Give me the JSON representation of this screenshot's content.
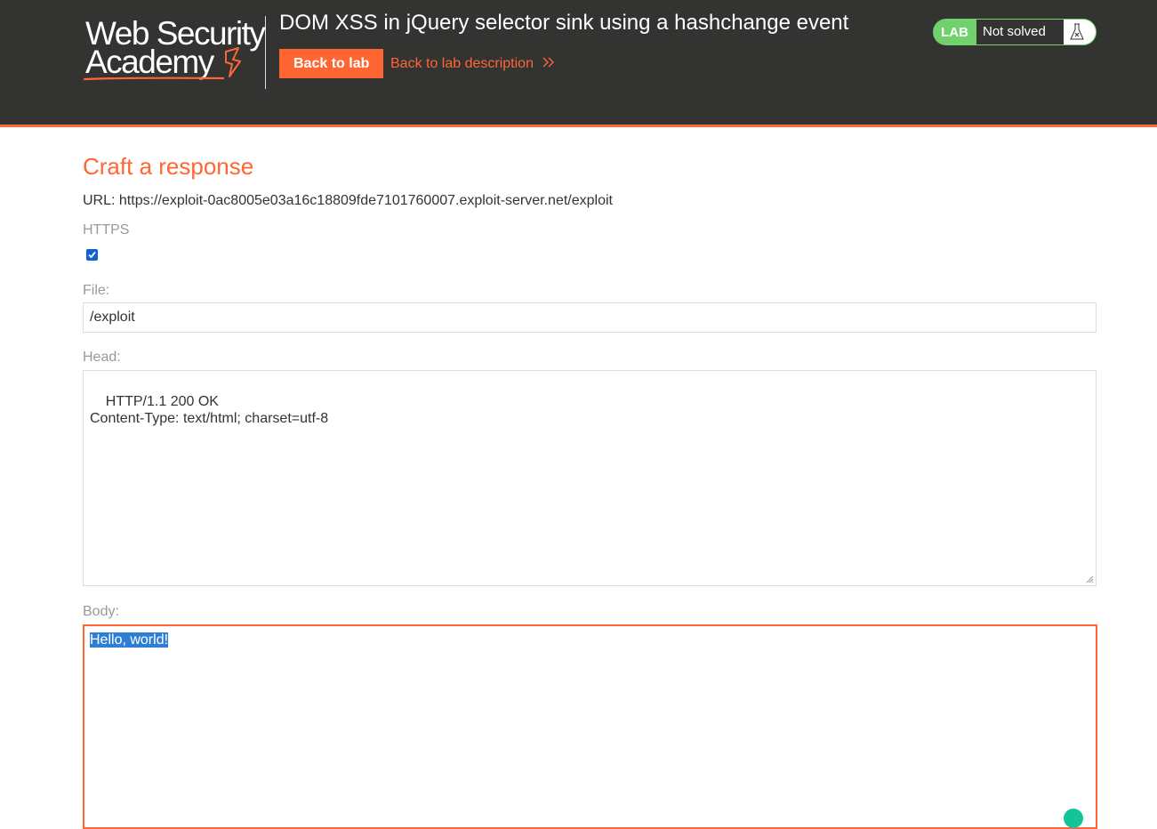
{
  "header": {
    "logo_line1": "Web Security",
    "logo_line2": "Academy",
    "lab_title": "DOM XSS in jQuery selector sink using a hashchange event",
    "back_to_lab": "Back to lab",
    "back_to_description": "Back to lab description",
    "lab_tag": "LAB",
    "lab_status": "Not solved",
    "accent_color": "#ff6633",
    "status_color": "#70d16d"
  },
  "form": {
    "title": "Craft a response",
    "url_label": "URL:",
    "url_value": "https://exploit-0ac8005e03a16c18809fde7101760007.exploit-server.net/exploit",
    "https_label": "HTTPS",
    "https_checked": true,
    "file_label": "File:",
    "file_value": "/exploit",
    "head_label": "Head:",
    "head_value": "HTTP/1.1 200 OK\nContent-Type: text/html; charset=utf-8",
    "body_label": "Body:",
    "body_value": "Hello, world!"
  }
}
